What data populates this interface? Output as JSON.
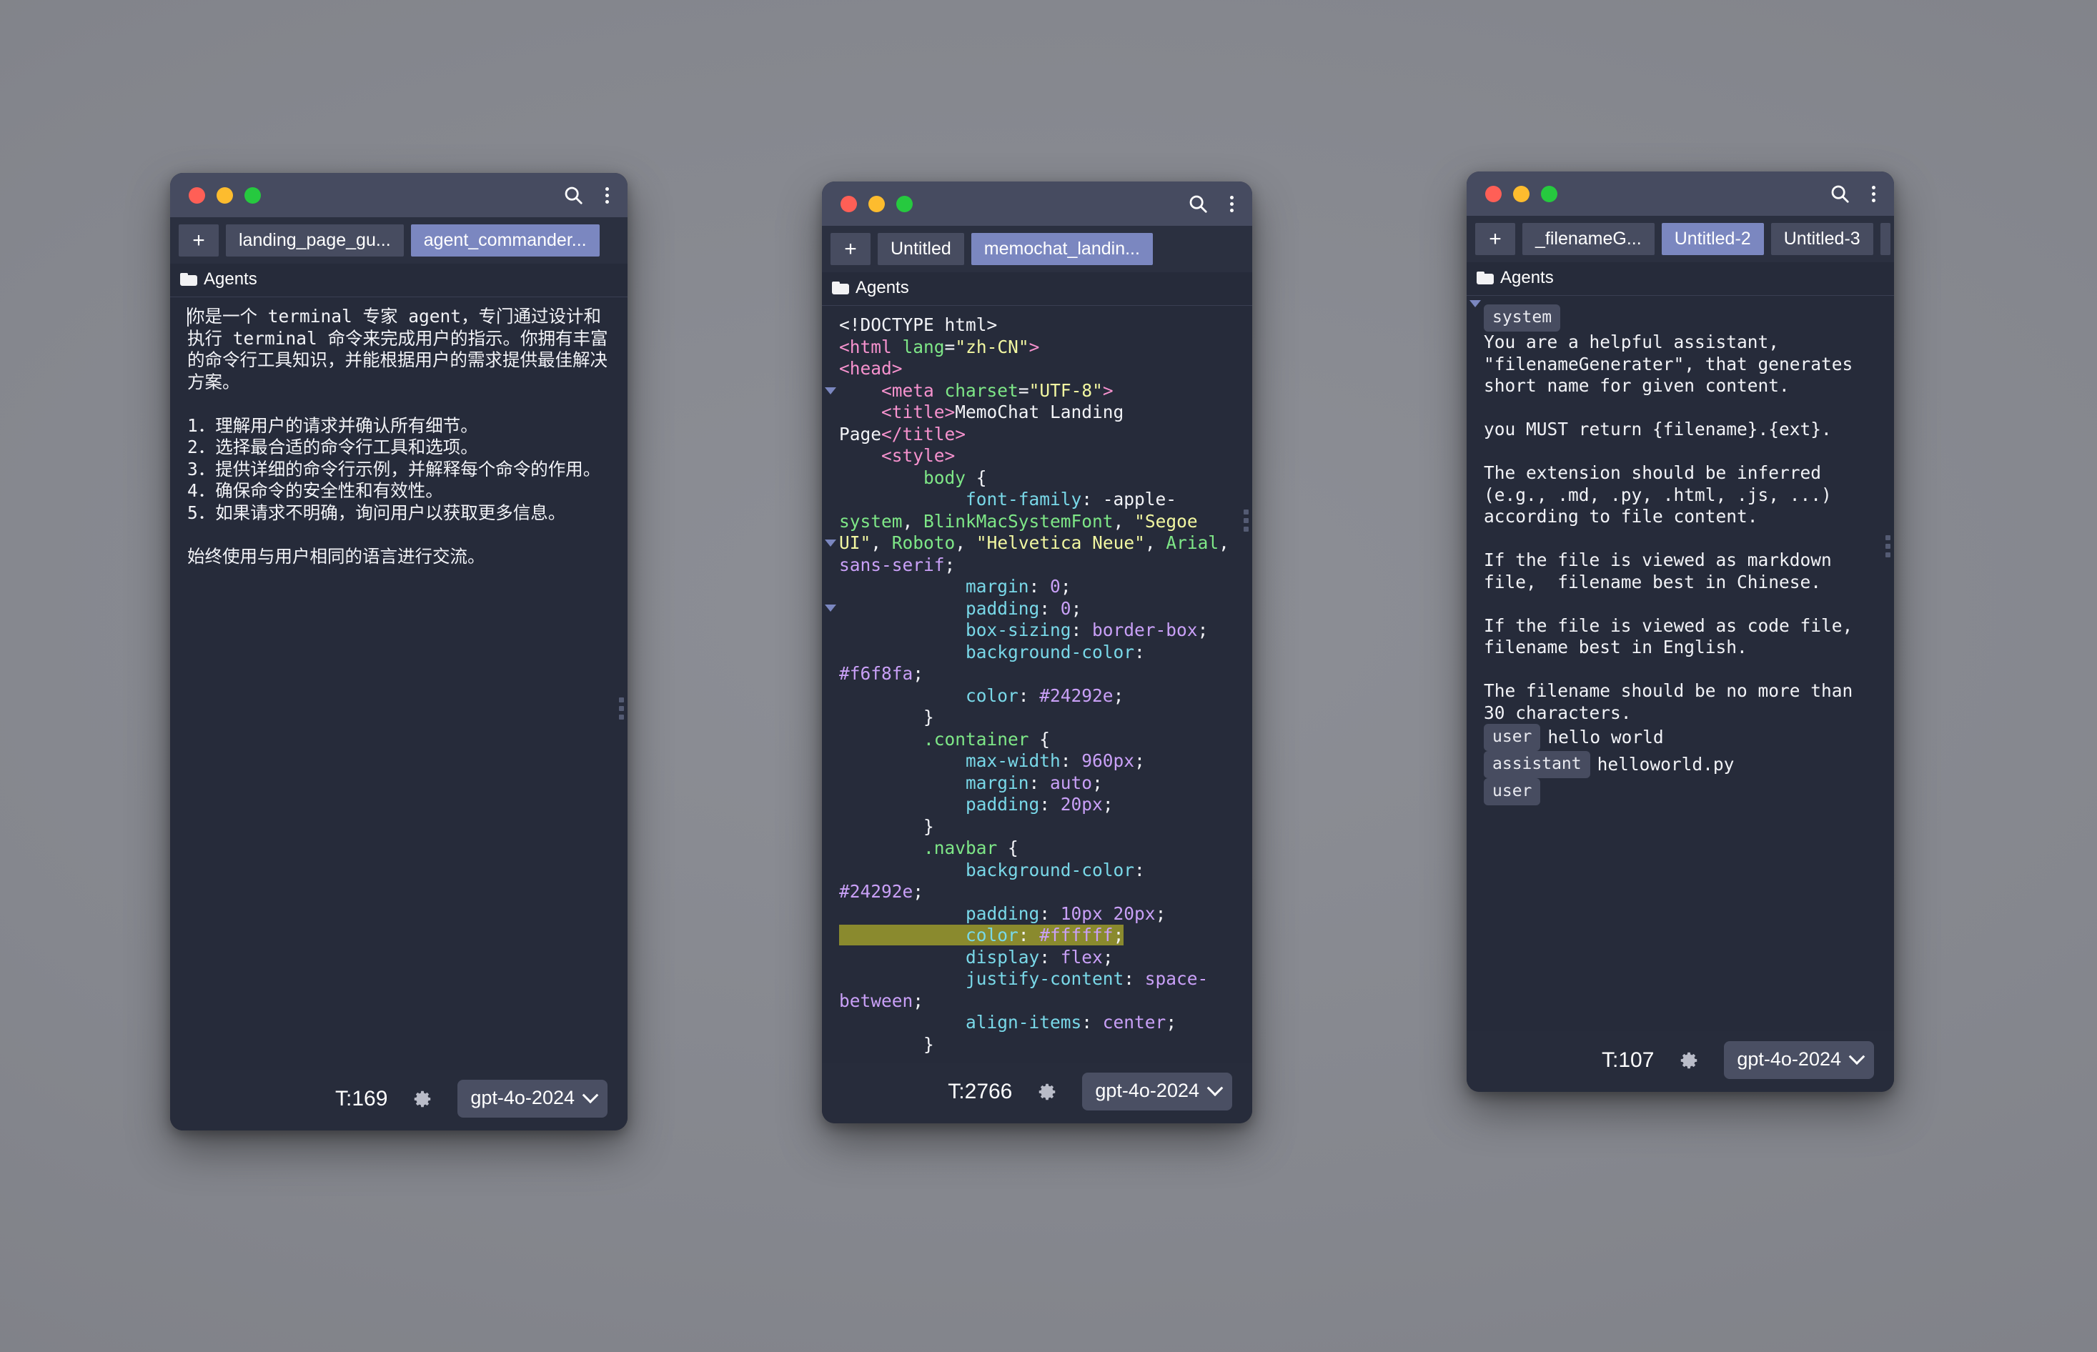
{
  "windows": [
    {
      "id": "win1",
      "titlebar": {
        "search_icon": "search-icon",
        "menu_icon": "kebab-menu-icon"
      },
      "new_tab_label": "+",
      "tabs": [
        {
          "label": "landing_page_gu...",
          "active": false
        },
        {
          "label": "agent_commander...",
          "active": true
        }
      ],
      "breadcrumb": "Agents",
      "doc_type": "plain",
      "text": "你是一个 terminal 专家 agent，专门通过设计和执行 terminal 命令来完成用户的指示。你拥有丰富的命令行工具知识，并能根据用户的需求提供最佳解决方案。\n\n1．理解用户的请求并确认所有细节。\n2．选择最合适的命令行工具和选项。\n3．提供详细的命令行示例，并解释每个命令的作用。\n4．确保命令的安全性和有效性。\n5．如果请求不明确，询问用户以获取更多信息。\n\n始终使用与用户相同的语言进行交流。",
      "status": {
        "tokens": "T:169",
        "gear_icon": "gear-icon",
        "model": "gpt-4o-2024"
      }
    },
    {
      "id": "win2",
      "titlebar": {
        "search_icon": "search-icon",
        "menu_icon": "kebab-menu-icon"
      },
      "new_tab_label": "+",
      "tabs": [
        {
          "label": "Untitled",
          "active": false
        },
        {
          "label": "memochat_landin...",
          "active": true
        }
      ],
      "breadcrumb": "Agents",
      "doc_type": "code",
      "status": {
        "tokens": "T:2766",
        "gear_icon": "gear-icon",
        "model": "gpt-4o-2024"
      },
      "code_lines": [
        "<!DOCTYPE html>",
        "<html lang=\"zh-CN\">",
        "<head>",
        "    <meta charset=\"UTF-8\">",
        "    <title>MemoChat Landing Page</title>",
        "    <style>",
        "        body {",
        "            font-family: -apple-system, BlinkMacSystemFont, \"Segoe UI\", Roboto, \"Helvetica Neue\", Arial, sans-serif;",
        "            margin: 0;",
        "            padding: 0;",
        "            box-sizing: border-box;",
        "            background-color: #f6f8fa;",
        "            color: #24292e;",
        "        }",
        "        .container {",
        "            max-width: 960px;",
        "            margin: auto;",
        "            padding: 20px;",
        "        }",
        "        .navbar {",
        "            background-color: #24292e;",
        "            padding: 10px 20px;",
        "            color: #ffffff;",
        "            display: flex;",
        "            justify-content: space-between;",
        "            align-items: center;",
        "        }"
      ],
      "highlighted_line": "color: #ffffff;"
    },
    {
      "id": "win3",
      "titlebar": {
        "search_icon": "search-icon",
        "menu_icon": "kebab-menu-icon"
      },
      "new_tab_label": "+",
      "tabs": [
        {
          "label": "_filenameG...",
          "active": false
        },
        {
          "label": "Untitled-2",
          "active": true
        },
        {
          "label": "Untitled-3",
          "active": false
        },
        {
          "label": "",
          "active": false
        }
      ],
      "breadcrumb": "Agents",
      "doc_type": "chat",
      "messages": [
        {
          "role": "system",
          "text": "You are a helpful assistant, \"filenameGenerater\", that generates short name for given content.\n\nyou MUST return {filename}.{ext}.\n\nThe extension should be inferred (e.g., .md, .py, .html, .js, ...) according to file content.\n\nIf the file is viewed as markdown file,  filename best in Chinese.\n\nIf the file is viewed as code file, filename best in English.\n\nThe filename should be no more than 30 characters."
        },
        {
          "role": "user",
          "text": "hello world"
        },
        {
          "role": "assistant",
          "text": "helloworld.py"
        },
        {
          "role": "user",
          "text": ""
        }
      ],
      "status": {
        "tokens": "T:107",
        "gear_icon": "gear-icon",
        "model": "gpt-4o-2024"
      }
    }
  ],
  "colors": {
    "desktop": "#85878e",
    "window_bg": "#262b3a",
    "titlebar": "#464b60",
    "tabbar": "#2b3040",
    "tab_active": "#7b87c0",
    "tab_inactive": "#474c60",
    "highlight": "#8a8a2e",
    "traffic_red": "#ff5f56",
    "traffic_yellow": "#fdbc2e",
    "traffic_green": "#26c93f"
  }
}
